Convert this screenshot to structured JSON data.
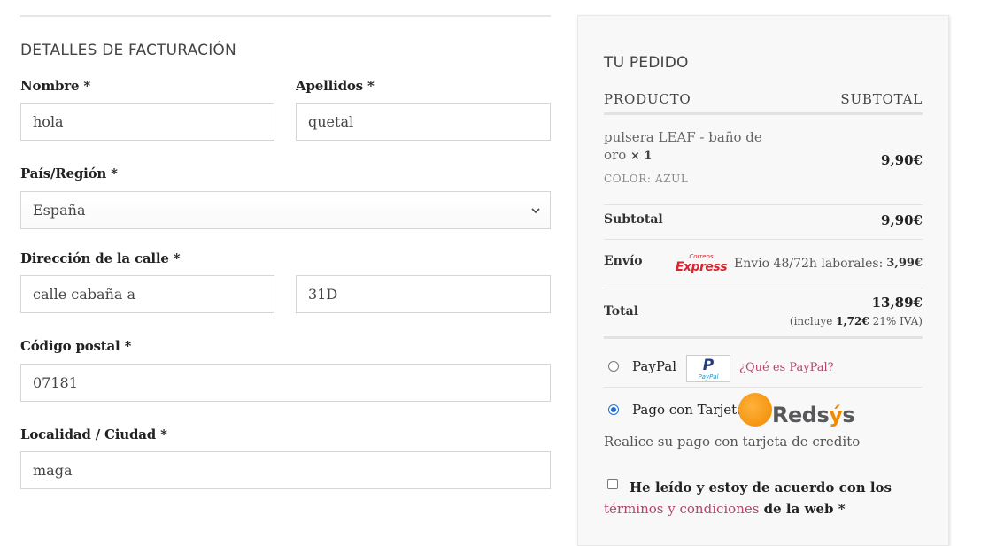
{
  "billing": {
    "title": "DETALLES DE FACTURACIÓN",
    "first_name": {
      "label": "Nombre",
      "required": "*",
      "value": "hola"
    },
    "last_name": {
      "label": "Apellidos",
      "required": "*",
      "value": "quetal"
    },
    "country": {
      "label": "País/Región",
      "required": "*",
      "value": "España"
    },
    "street": {
      "label": "Dirección de la calle",
      "required": "*",
      "value": "calle cabaña a",
      "value2": "31D"
    },
    "postcode": {
      "label": "Código postal",
      "required": "*",
      "value": "07181"
    },
    "city": {
      "label": "Localidad / Ciudad",
      "required": "*",
      "value": "maga"
    }
  },
  "order": {
    "title": "TU PEDIDO",
    "col_product": "PRODUCTO",
    "col_subtotal": "SUBTOTAL",
    "item": {
      "name": "pulsera LEAF - baño de oro",
      "qty": "× 1",
      "attr_label": "COLOR:",
      "attr_value": "AZUL",
      "price": "9,90€"
    },
    "subtotal_label": "Subtotal",
    "subtotal_value": "9,90€",
    "shipping_label": "Envío",
    "shipping_logo_small": "Correos",
    "shipping_logo_big": "Express",
    "shipping_text": "Envio 48/72h laborales:",
    "shipping_price": "3,99€",
    "total_label": "Total",
    "total_value": "13,89€",
    "tax_prefix": "(incluye",
    "tax_amount": "1,72€",
    "tax_suffix": "21% IVA)"
  },
  "payment": {
    "paypal_label": "PayPal",
    "paypal_logo_p": "P",
    "paypal_logo_text": "PayPal",
    "paypal_link": "¿Qué es PayPal?",
    "card_label": "Pago con Tarjeta",
    "redsys_word": "Reds",
    "redsys_accent": "ý",
    "redsys_end": "s",
    "card_desc": "Realice su pago con tarjeta de credito"
  },
  "terms": {
    "text_before": "He leído y estoy de acuerdo con los ",
    "link": "términos y condiciones",
    "text_after": " de la web",
    "required": "*"
  },
  "colors": {
    "link": "#b0466e",
    "radio_checked": "#1f6fd6",
    "correos": "#d8262e",
    "redsys_orange": "#f08a00"
  }
}
